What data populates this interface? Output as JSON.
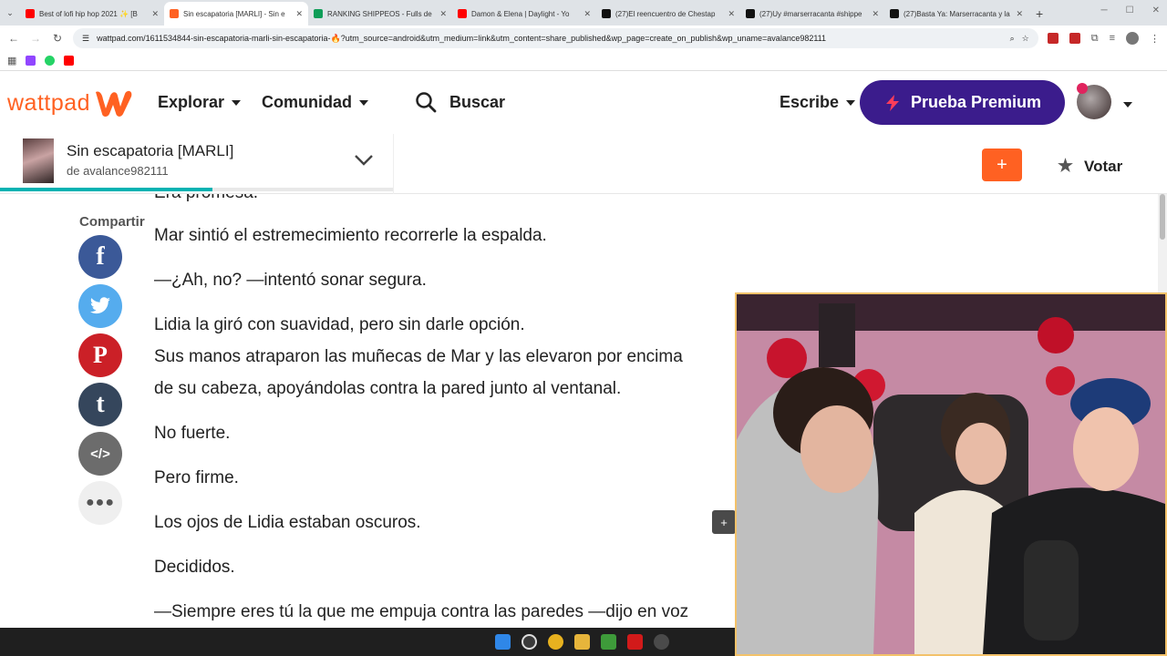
{
  "browser": {
    "tabs": [
      {
        "label": "Best of lofi hip hop 2021 ✨ [B",
        "color": "#ff0000",
        "active": false
      },
      {
        "label": "Sin escapatoria [MARLI] - Sin e",
        "color": "#ff6122",
        "active": true
      },
      {
        "label": "RANKING SHIPPEOS - Fulls de",
        "color": "#0f9d58",
        "active": false
      },
      {
        "label": "Damon & Elena | Daylight - Yo",
        "color": "#ff0000",
        "active": false
      },
      {
        "label": "(27)El reencuentro de Chestap",
        "color": "#111111",
        "active": false
      },
      {
        "label": "(27)Uy #marserracanta #shippe",
        "color": "#111111",
        "active": false
      },
      {
        "label": "(27)Basta Ya: Marserracanta y la",
        "color": "#111111",
        "active": false
      }
    ],
    "new_tab": "+",
    "url": "wattpad.com/1611534844-sin-escapatoria-marli-sin-escapatoria-🔥?utm_source=android&utm_medium=link&utm_content=share_published&wp_page=create_on_publish&wp_uname=avalance982111"
  },
  "header": {
    "logo_text": "wattpad",
    "explore": "Explorar",
    "community": "Comunidad",
    "search": "Buscar",
    "write": "Escribe",
    "premium": "Prueba Premium"
  },
  "story": {
    "title": "Sin escapatoria [MARLI]",
    "author": "de avalance982111",
    "progress": 0.54,
    "add": "+",
    "vote": "Votar"
  },
  "share": {
    "label": "Compartir",
    "buttons": [
      {
        "name": "facebook",
        "glyph": "f",
        "color": "#3b5998"
      },
      {
        "name": "twitter",
        "glyph": "t",
        "color": "#55acee"
      },
      {
        "name": "pinterest",
        "glyph": "P",
        "color": "#cb2027"
      },
      {
        "name": "tumblr",
        "glyph": "t",
        "color": "#35465c"
      },
      {
        "name": "embed",
        "glyph": "</>",
        "color": "#6c6c6c"
      },
      {
        "name": "more",
        "glyph": "•••",
        "color": "#efefef"
      }
    ]
  },
  "text": {
    "top_partial": "Era promesa.",
    "paragraphs": [
      "Mar sintió el estremecimiento recorrerle la espalda.",
      "—¿Ah, no? —intentó sonar segura.",
      "Lidia la giró con suavidad, pero sin darle opción.",
      "Sus manos atraparon las muñecas de Mar y las elevaron por encima",
      "de su cabeza, apoyándolas contra la pared junto al ventanal.",
      "No fuerte.",
      "Pero firme.",
      "Los ojos de Lidia estaban oscuros.",
      "Decididos.",
      "—Siempre eres tú la que me empuja contra las paredes —dijo en voz"
    ]
  },
  "comment_btn": "+"
}
